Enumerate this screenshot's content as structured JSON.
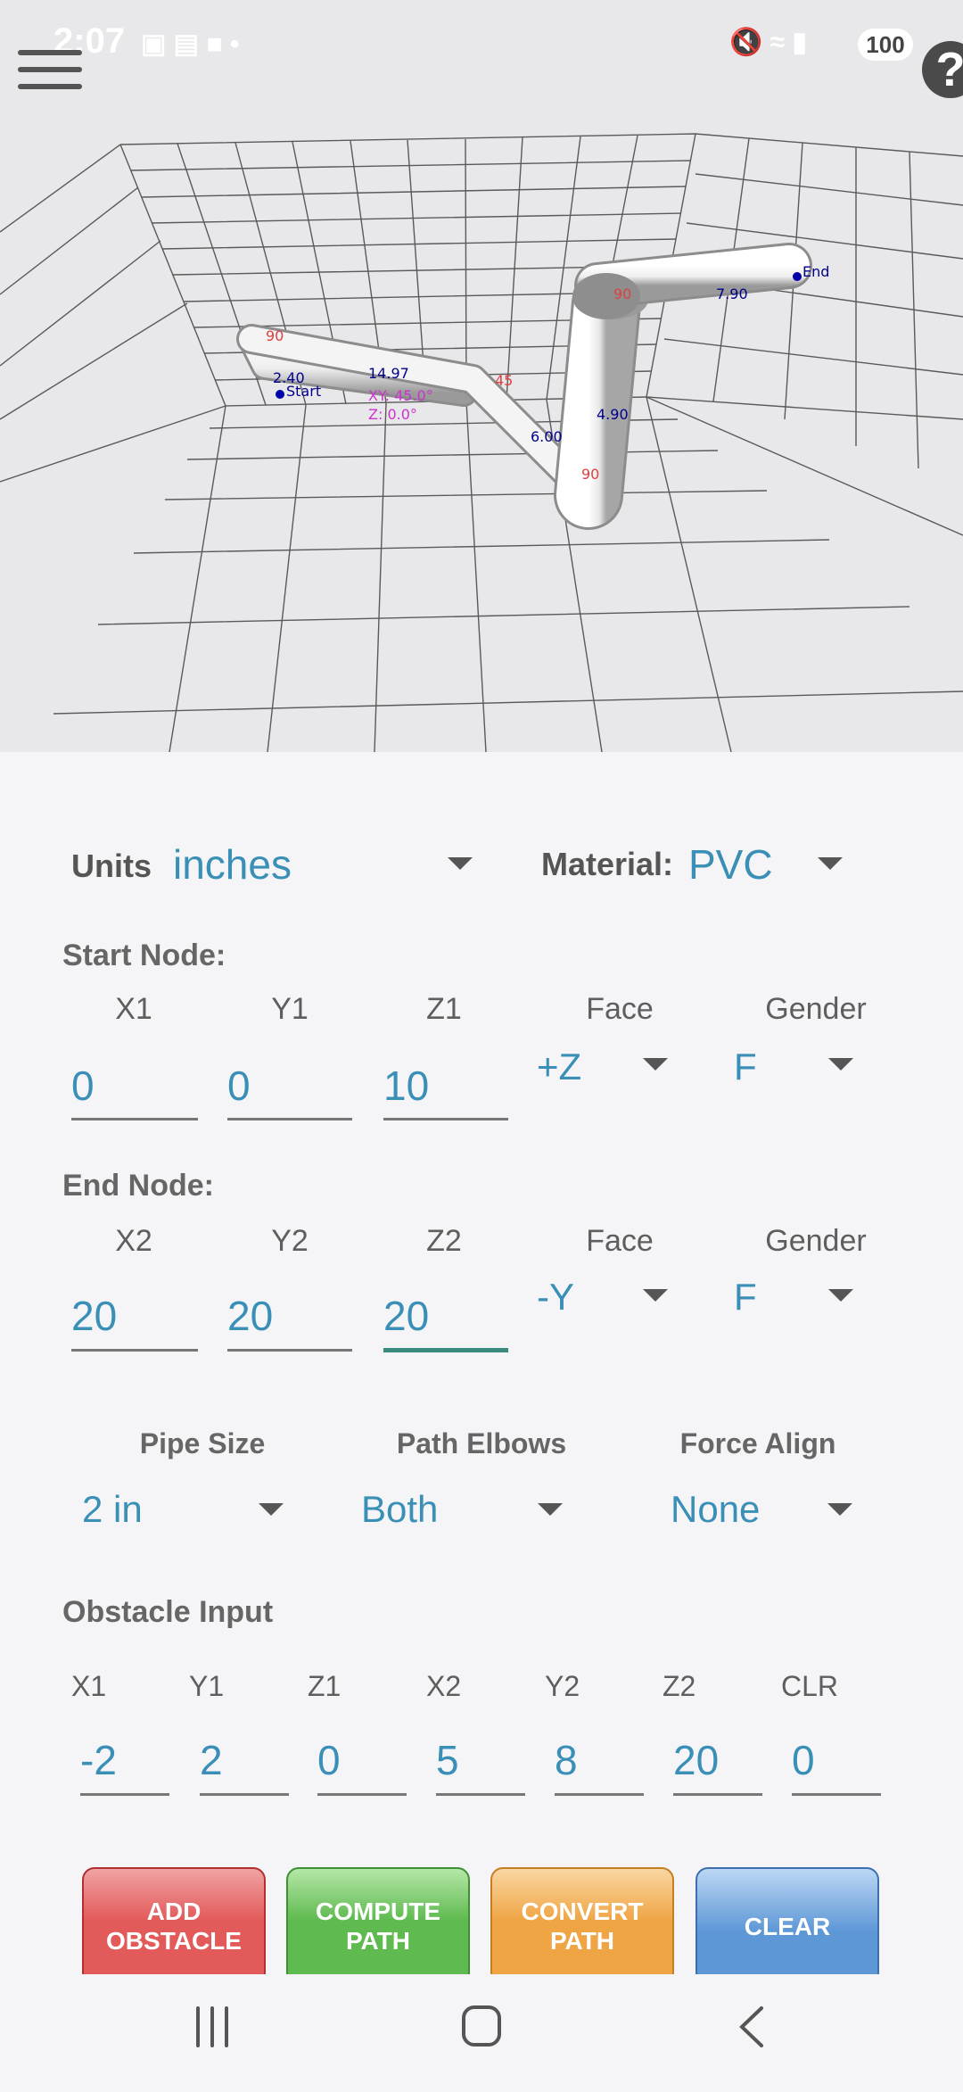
{
  "status_bar": {
    "time": "2:07",
    "battery": "100"
  },
  "viewport": {
    "labels": {
      "start": "Start",
      "end": "End",
      "seg1": "2.40",
      "seg2": "14.97",
      "seg2_xy": "XY: 45.0°",
      "seg2_z": "Z: 0.0°",
      "seg3": "6.00",
      "seg4": "4.90",
      "seg5": "7.90",
      "elbow1": "90",
      "elbow2": "45",
      "elbow3": "90",
      "elbow4": "90"
    }
  },
  "units": {
    "label": "Units",
    "value": "inches"
  },
  "material": {
    "label": "Material:",
    "value": "PVC"
  },
  "start_node": {
    "title": "Start Node:",
    "headers": [
      "X1",
      "Y1",
      "Z1",
      "Face",
      "Gender"
    ],
    "x": "0",
    "y": "0",
    "z": "10",
    "face": "+Z",
    "gender": "F"
  },
  "end_node": {
    "title": "End Node:",
    "headers": [
      "X2",
      "Y2",
      "Z2",
      "Face",
      "Gender"
    ],
    "x": "20",
    "y": "20",
    "z": "20",
    "face": "-Y",
    "gender": "F"
  },
  "options": {
    "pipe_size_label": "Pipe Size",
    "pipe_size": "2 in",
    "path_elbows_label": "Path Elbows",
    "path_elbows": "Both",
    "force_align_label": "Force Align",
    "force_align": "None"
  },
  "obstacle": {
    "title": "Obstacle Input",
    "fields": [
      {
        "label": "X1",
        "value": "-2"
      },
      {
        "label": "Y1",
        "value": "2"
      },
      {
        "label": "Z1",
        "value": "0"
      },
      {
        "label": "X2",
        "value": "5"
      },
      {
        "label": "Y2",
        "value": "8"
      },
      {
        "label": "Z2",
        "value": "20"
      },
      {
        "label": "CLR",
        "value": "0"
      }
    ]
  },
  "buttons": {
    "add_obstacle": "ADD OBSTACLE",
    "compute_path": "COMPUTE PATH",
    "convert_path": "CONVERT PATH",
    "clear": "CLEAR"
  },
  "colors": {
    "accent": "#3a8fb7",
    "add": "#e35a5a",
    "compute": "#5fba4f",
    "convert": "#f0a545",
    "clear": "#5d97d6"
  }
}
